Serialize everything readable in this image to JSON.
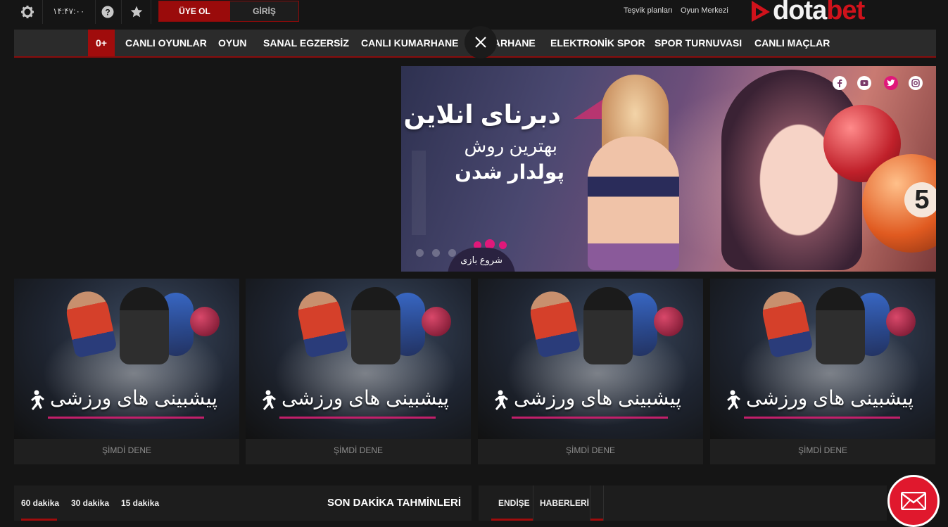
{
  "topbar": {
    "time": "۱۴:۴۷:۰۰",
    "register_label": "ÜYE OL",
    "login_label": "GİRİŞ",
    "links": [
      "Teşvik planları",
      "Oyun Merkezi"
    ],
    "icons": [
      "gear-icon",
      "help-icon",
      "star-icon"
    ]
  },
  "logo": {
    "part1": "dota",
    "part2": "bet"
  },
  "nav": {
    "first": "0+",
    "items": [
      "CANLI OYUNLAR",
      "OYUN",
      "SANAL EGZERSİZ",
      "CANLI KUMARHANE",
      "KUMARHANE",
      "ELEKTRONİK SPOR",
      "SPOR TURNUVASI",
      "CANLI MAÇLAR"
    ]
  },
  "banner": {
    "title": "دبرنای انلاین",
    "subtitle1": "بهترین روش",
    "subtitle2": "پولدار شدن",
    "start_label": "شروع بازی",
    "social_icons": [
      "facebook-icon",
      "youtube-icon",
      "twitter-icon",
      "instagram-icon"
    ],
    "colors": {
      "accent": "#e0187a"
    }
  },
  "cards": [
    {
      "title": "پیشبینی های ورزشی",
      "cta": "ŞİMDİ DENE"
    },
    {
      "title": "پیشبینی های ورزشی",
      "cta": "ŞİMDİ DENE"
    },
    {
      "title": "پیشبینی های ورزشی",
      "cta": "ŞİMDİ DENE"
    },
    {
      "title": "پیشبینی های ورزشی",
      "cta": "ŞİMDİ DENE"
    }
  ],
  "predictions": {
    "tabs": [
      "60 dakika",
      "30 dakika",
      "15 dakika"
    ],
    "title": "SON DAKİKA TAHMİNLERİ"
  },
  "news": {
    "tabs": [
      "ENDİŞE",
      "HABERLERİ"
    ]
  },
  "colors": {
    "brand_red": "#a00c0c",
    "background": "#151515"
  }
}
